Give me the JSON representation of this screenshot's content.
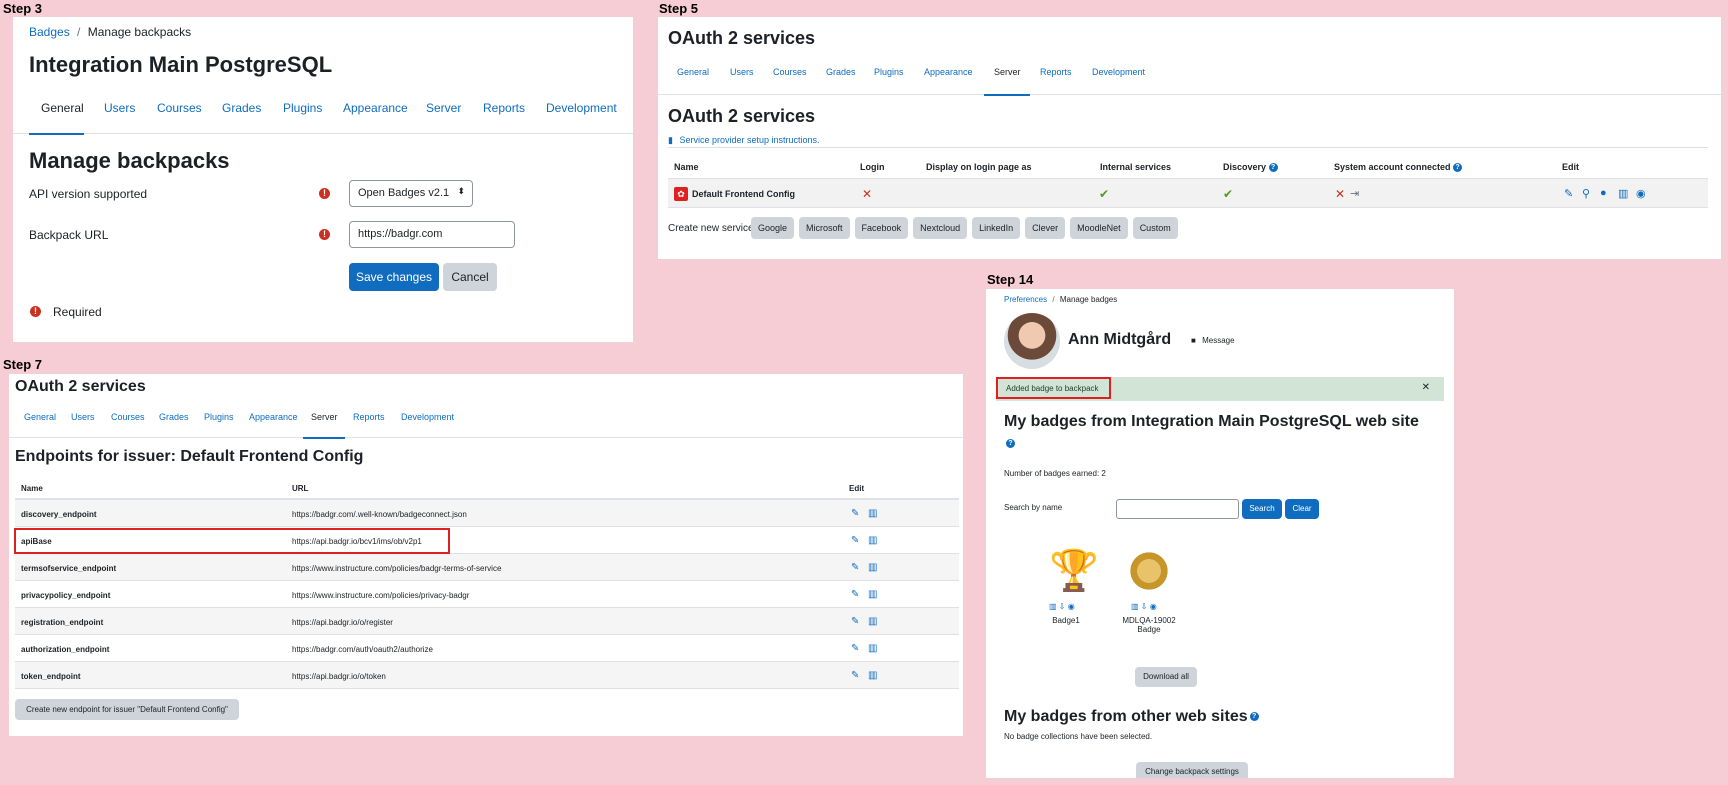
{
  "step3": {
    "label": "Step 3",
    "breadcrumb": [
      "Badges",
      "Manage backpacks"
    ],
    "title": "Integration Main PostgreSQL",
    "tabs": [
      "General",
      "Users",
      "Courses",
      "Grades",
      "Plugins",
      "Appearance",
      "Server",
      "Reports",
      "Development"
    ],
    "heading": "Manage backpacks",
    "api_label": "API version supported",
    "api_value": "Open Badges v2.1",
    "url_label": "Backpack URL",
    "url_value": "https://badgr.com",
    "save": "Save changes",
    "cancel": "Cancel",
    "required": "Required"
  },
  "step5": {
    "label": "Step 5",
    "title": "OAuth 2 services",
    "tabs": [
      "General",
      "Users",
      "Courses",
      "Grades",
      "Plugins",
      "Appearance",
      "Server",
      "Reports",
      "Development"
    ],
    "heading": "OAuth 2 services",
    "setup_link": "Service provider setup instructions.",
    "columns": [
      "Name",
      "Login",
      "Display on login page as",
      "Internal services",
      "Discovery",
      "System account connected",
      "Edit"
    ],
    "row_name": "Default Frontend Config",
    "create_label": "Create new service:",
    "services": [
      "Google",
      "Microsoft",
      "Facebook",
      "Nextcloud",
      "LinkedIn",
      "Clever",
      "MoodleNet",
      "Custom"
    ]
  },
  "step7": {
    "label": "Step 7",
    "title": "OAuth 2 services",
    "tabs": [
      "General",
      "Users",
      "Courses",
      "Grades",
      "Plugins",
      "Appearance",
      "Server",
      "Reports",
      "Development"
    ],
    "heading": "Endpoints for issuer: Default Frontend Config",
    "columns": [
      "Name",
      "URL",
      "Edit"
    ],
    "rows": [
      {
        "name": "discovery_endpoint",
        "url": "https://badgr.com/.well-known/badgeconnect.json"
      },
      {
        "name": "apiBase",
        "url": "https://api.badgr.io/bcv1/ims/ob/v2p1"
      },
      {
        "name": "termsofservice_endpoint",
        "url": "https://www.instructure.com/policies/badgr-terms-of-service"
      },
      {
        "name": "privacypolicy_endpoint",
        "url": "https://www.instructure.com/policies/privacy-badgr"
      },
      {
        "name": "registration_endpoint",
        "url": "https://api.badgr.io/o/register"
      },
      {
        "name": "authorization_endpoint",
        "url": "https://badgr.com/auth/oauth2/authorize"
      },
      {
        "name": "token_endpoint",
        "url": "https://api.badgr.io/o/token"
      }
    ],
    "create_button": "Create new endpoint for issuer \"Default Frontend Config\""
  },
  "step14": {
    "label": "Step 14",
    "breadcrumb": [
      "Preferences",
      "Manage badges"
    ],
    "user": "Ann Midtgård",
    "message": "Message",
    "alert": "Added badge to backpack",
    "heading1": "My badges from Integration Main PostgreSQL web site",
    "count": "Number of badges earned: 2",
    "search_label": "Search by name",
    "search_btn": "Search",
    "clear_btn": "Clear",
    "badges": [
      {
        "name": "Badge1"
      },
      {
        "name": "MDLQA-19002 Badge"
      }
    ],
    "download_all": "Download all",
    "heading2": "My badges from other web sites",
    "no_collections": "No badge collections have been selected.",
    "change_settings": "Change backpack settings"
  },
  "colors": {
    "brand": "#0f6cbf",
    "alert_bg": "#d2e4d6",
    "highlight": "#e02020",
    "background": "#f6cdd4"
  }
}
